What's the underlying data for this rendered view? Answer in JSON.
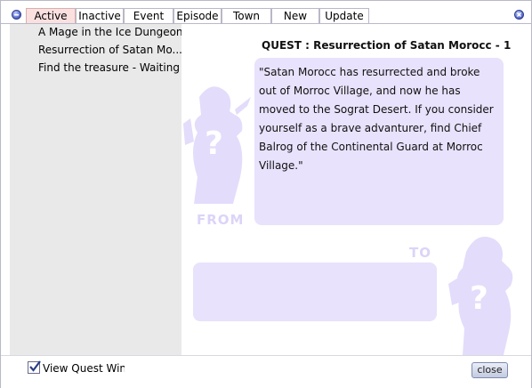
{
  "window": {
    "tabs": [
      {
        "label": "Active",
        "active": true
      },
      {
        "label": "Inactive",
        "active": false
      },
      {
        "label": "Event",
        "active": false
      },
      {
        "label": "Episode",
        "active": false
      },
      {
        "label": "Town",
        "active": false
      },
      {
        "label": "New",
        "active": false
      },
      {
        "label": "Update",
        "active": false
      }
    ]
  },
  "quest_list": {
    "items": [
      {
        "label": "A Mage in the Ice Dungeon"
      },
      {
        "label": "Resurrection of Satan Mo..."
      },
      {
        "label": "Find the treasure - Waiting"
      }
    ]
  },
  "quest_detail": {
    "title": "QUEST : Resurrection of Satan Morocc - 1",
    "description": "\"Satan Morocc has resurrected and broke out of Morroc Village, and now he has moved to the Sograt Desert. If you consider yourself as a brave advanturer, find Chief Balrog of the Continental Guard at Morroc Village.\"",
    "from_label": "FROM",
    "to_label": "TO"
  },
  "bottom": {
    "view_quest_label": "View Quest Wind",
    "view_quest_checked": true,
    "close_label": "close"
  },
  "colors": {
    "active_tab": "#fbe0e0",
    "panel_bg": "#e9e9e9",
    "box_bg": "#e8e2fc",
    "silhouette": "#e3dcfb"
  }
}
